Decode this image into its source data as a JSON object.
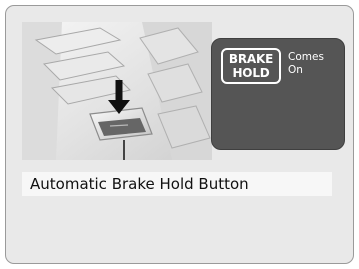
{
  "indicator": {
    "badge_line1": "BRAKE",
    "badge_line2": "HOLD",
    "status_line1": "Comes",
    "status_line2": "On"
  },
  "caption": "Automatic Brake Hold Button",
  "colors": {
    "frame_background": "#e9e9e9",
    "indicator_panel": "#555555",
    "indicator_text": "#ffffff"
  }
}
